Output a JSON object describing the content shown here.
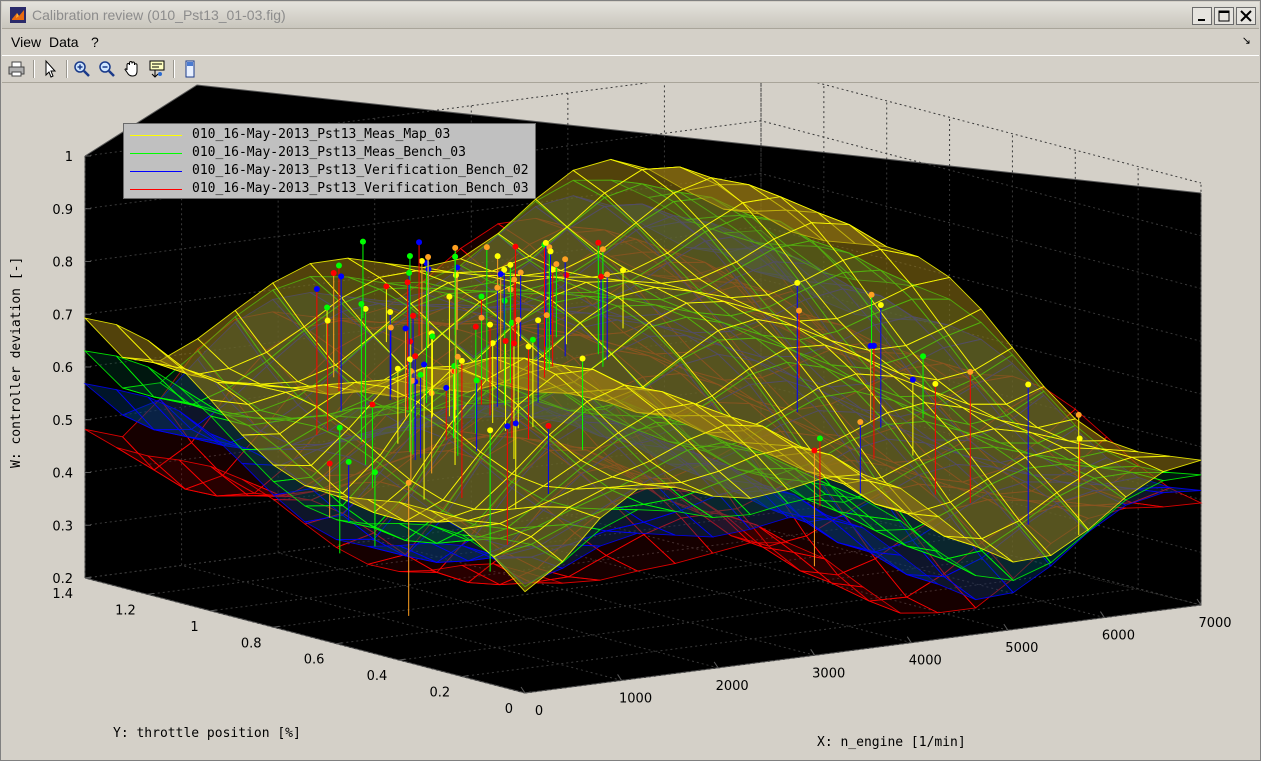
{
  "window": {
    "title": "Calibration review (010_Pst13_01-03.fig)",
    "buttons": [
      "minimize",
      "maximize",
      "close"
    ]
  },
  "menu": {
    "items": [
      "View",
      "Data",
      "?"
    ],
    "corner_glyph": "↘"
  },
  "toolbar": {
    "tools": [
      "print-icon",
      "pointer-icon",
      "zoom-in-icon",
      "zoom-out-icon",
      "pan-icon",
      "data-cursor-icon",
      "colorbar-icon"
    ]
  },
  "plot": {
    "xlabel": "X: n_engine [1/min]",
    "ylabel": "Y: throttle position [%]",
    "zlabel": "W: controller deviation [-]",
    "x_ticks": [
      "0",
      "1000",
      "2000",
      "3000",
      "4000",
      "5000",
      "6000",
      "7000"
    ],
    "y_ticks": [
      "0",
      "0.2",
      "0.4",
      "0.6",
      "0.8",
      "1",
      "1.2",
      "1.4"
    ],
    "z_ticks": [
      "0.2",
      "0.3",
      "0.4",
      "0.5",
      "0.6",
      "0.7",
      "0.8",
      "0.9",
      "1"
    ],
    "legend": [
      {
        "label": "010_16-May-2013_Pst13_Meas_Map_03",
        "color": "#ffff00"
      },
      {
        "label": "010_16-May-2013_Pst13_Meas_Bench_03",
        "color": "#00ff00"
      },
      {
        "label": "010_16-May-2013_Pst13_Verification_Bench_02",
        "color": "#0000ff"
      },
      {
        "label": "010_16-May-2013_Pst13_Verification_Bench_03",
        "color": "#ff0000"
      }
    ],
    "axes_background": "#000000",
    "figure_background": "#d4d0c8",
    "legend_background": "#c0c0c0"
  }
}
